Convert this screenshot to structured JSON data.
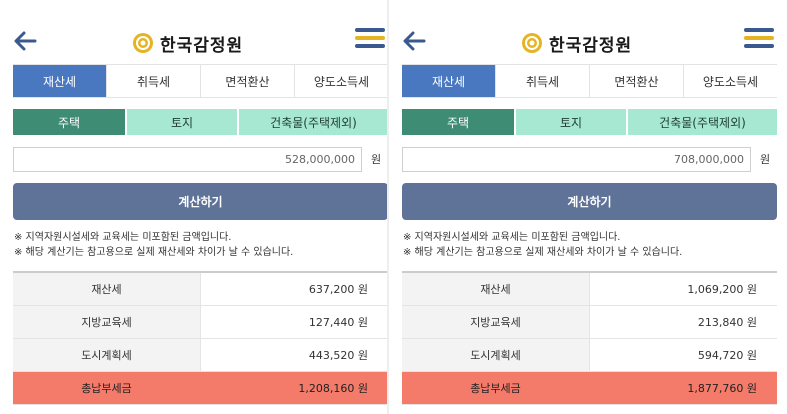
{
  "colors": {
    "active_tab": "#4a78c0",
    "active_subtab": "#3f8c74",
    "subtab": "#a6e8d2",
    "calc_button": "#5f7297",
    "total_row": "#f47a6a",
    "logo_yellow": "#e6b422",
    "menu_blue": "#3a5a8f"
  },
  "panels": [
    {
      "header": {
        "logo_text": "한국감정원",
        "back_icon": "arrow-left-icon",
        "menu_icon": "hamburger-menu-icon"
      },
      "tabs": [
        {
          "label": "재산세",
          "active": true
        },
        {
          "label": "취득세",
          "active": false
        },
        {
          "label": "면적환산",
          "active": false
        },
        {
          "label": "양도소득세",
          "active": false
        }
      ],
      "subtabs": [
        {
          "label": "주택",
          "active": true
        },
        {
          "label": "토지",
          "active": false
        },
        {
          "label": "건축물(주택제외)",
          "active": false
        }
      ],
      "amount": {
        "value": "528,000,000",
        "unit": "원"
      },
      "calc_button": "계산하기",
      "notes": [
        "※ 지역자원시설세와 교육세는 미포함된 금액입니다.",
        "※ 해당 계산기는 참고용으로 실제 재산세와 차이가 날 수 있습니다."
      ],
      "results": [
        {
          "label": "재산세",
          "value": "637,200 원"
        },
        {
          "label": "지방교육세",
          "value": "127,440 원"
        },
        {
          "label": "도시계획세",
          "value": "443,520 원"
        },
        {
          "label": "총납부세금",
          "value": "1,208,160 원"
        }
      ]
    },
    {
      "header": {
        "logo_text": "한국감정원",
        "back_icon": "arrow-left-icon",
        "menu_icon": "hamburger-menu-icon"
      },
      "tabs": [
        {
          "label": "재산세",
          "active": true
        },
        {
          "label": "취득세",
          "active": false
        },
        {
          "label": "면적환산",
          "active": false
        },
        {
          "label": "양도소득세",
          "active": false
        }
      ],
      "subtabs": [
        {
          "label": "주택",
          "active": true
        },
        {
          "label": "토지",
          "active": false
        },
        {
          "label": "건축물(주택제외)",
          "active": false
        }
      ],
      "amount": {
        "value": "708,000,000",
        "unit": "원"
      },
      "calc_button": "계산하기",
      "notes": [
        "※ 지역자원시설세와 교육세는 미포함된 금액입니다.",
        "※ 해당 계산기는 참고용으로 실제 재산세와 차이가 날 수 있습니다."
      ],
      "results": [
        {
          "label": "재산세",
          "value": "1,069,200 원"
        },
        {
          "label": "지방교육세",
          "value": "213,840 원"
        },
        {
          "label": "도시계획세",
          "value": "594,720 원"
        },
        {
          "label": "총납부세금",
          "value": "1,877,760 원"
        }
      ]
    }
  ]
}
